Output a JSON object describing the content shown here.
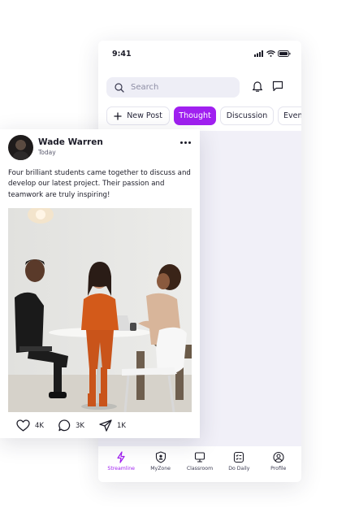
{
  "status_bar": {
    "time": "9:41"
  },
  "search": {
    "placeholder": "Search"
  },
  "tabs": [
    {
      "label": "New Post",
      "icon": "plus-icon"
    },
    {
      "label": "Thought",
      "active": true
    },
    {
      "label": "Discussion"
    },
    {
      "label": "Event"
    }
  ],
  "bottom_nav": [
    {
      "label": "Streamline",
      "icon": "lightning-icon",
      "active": true
    },
    {
      "label": "MyZone",
      "icon": "shield-user-icon"
    },
    {
      "label": "Classroom",
      "icon": "monitor-icon"
    },
    {
      "label": "Do Daily",
      "icon": "checklist-icon"
    },
    {
      "label": "Profile",
      "icon": "user-circle-icon"
    }
  ],
  "post": {
    "author": "Wade Warren",
    "time": "Today",
    "text": "Four brilliant students came together to discuss and develop our latest project. Their passion and teamwork are truly inspiring!",
    "likes": "4K",
    "comments": "3K",
    "shares": "1K"
  },
  "colors": {
    "accent": "#A020F0",
    "content_background": "#F1F0F8",
    "search_background": "#EEEEF6"
  }
}
